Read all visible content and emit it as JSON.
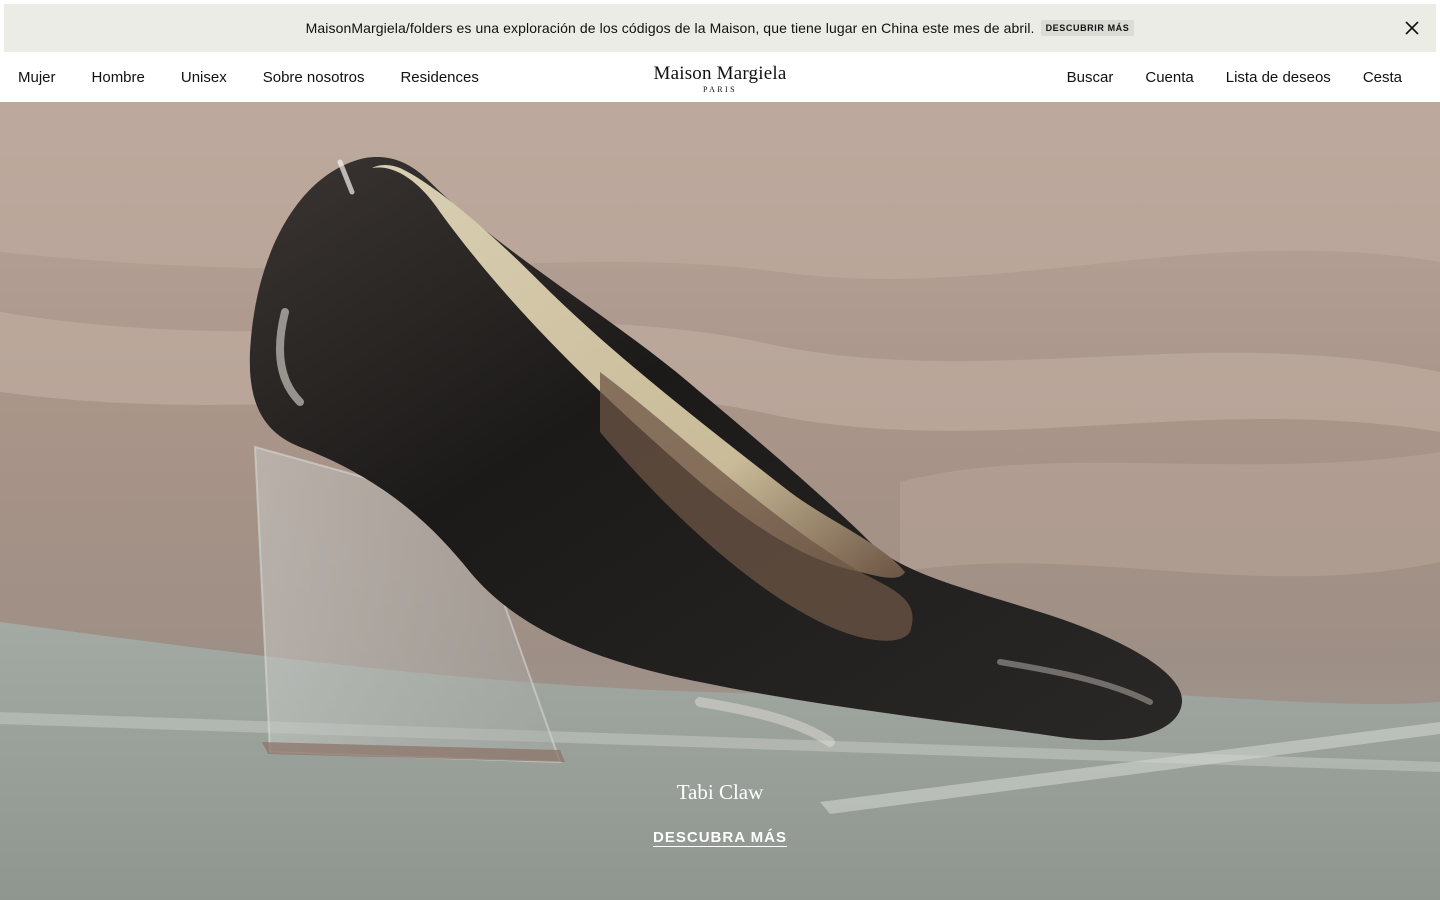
{
  "banner": {
    "text": "MaisonMargiela/folders es una exploración de los códigos de la Maison, que tiene lugar en China este mes de abril.",
    "cta_label": "DESCUBRIR MÁS",
    "close_icon": "close-icon"
  },
  "header": {
    "logo": {
      "main": "Maison Margiela",
      "sub": "PARIS"
    },
    "nav_left": [
      {
        "label": "Mujer"
      },
      {
        "label": "Hombre"
      },
      {
        "label": "Unisex"
      },
      {
        "label": "Sobre nosotros"
      },
      {
        "label": "Residences"
      }
    ],
    "nav_right": [
      {
        "label": "Buscar"
      },
      {
        "label": "Cuenta"
      },
      {
        "label": "Lista de deseos"
      },
      {
        "label": "Cesta"
      }
    ]
  },
  "hero": {
    "title": "Tabi Claw",
    "cta_label": "DESCUBRA MÁS",
    "image_subject": "black-patent-pump-shoe-image"
  }
}
